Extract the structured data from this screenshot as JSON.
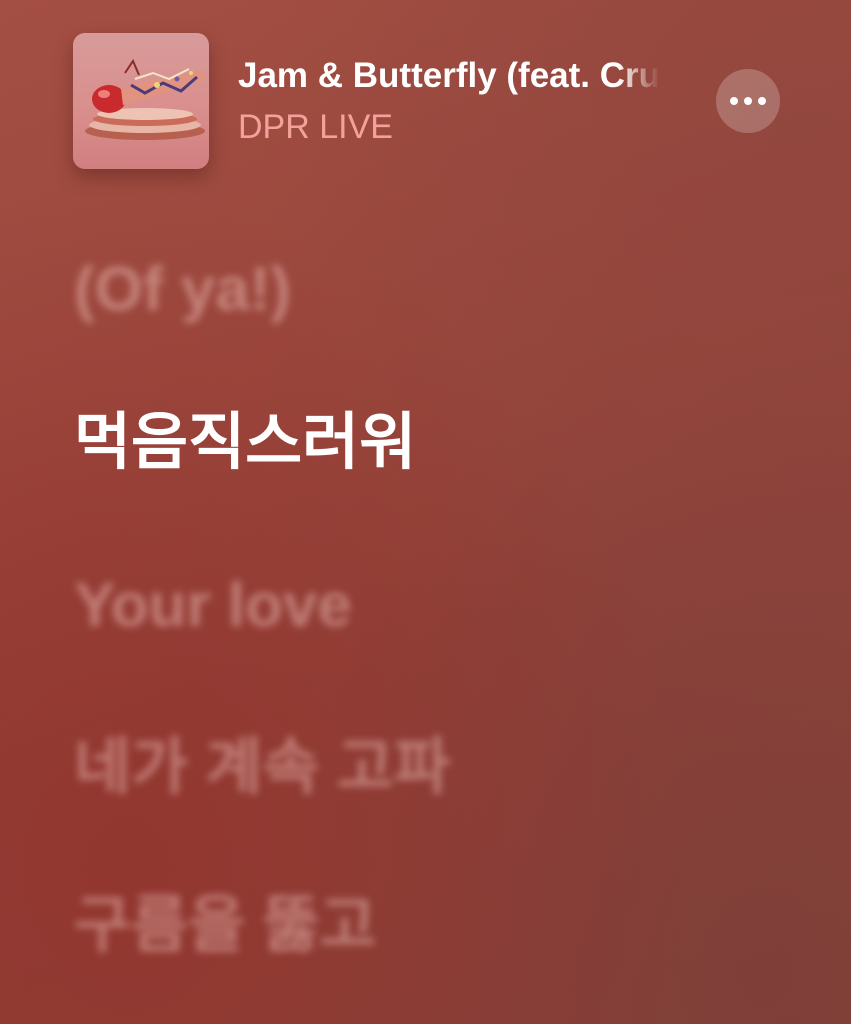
{
  "now_playing": {
    "title": "Jam & Butterfly (feat. Crush)",
    "artist": "DPR LIVE",
    "artwork_icon": "album-artwork",
    "more_icon": "ellipsis-icon"
  },
  "lyrics": {
    "lines": [
      {
        "text": "(Of ya!)",
        "active": false
      },
      {
        "text": "먹음직스러워",
        "active": true
      },
      {
        "text": "Your love",
        "active": false
      },
      {
        "text": "네가 계속 고파",
        "active": false
      },
      {
        "text": "구름을 뚫고",
        "active": false
      }
    ]
  },
  "colors": {
    "background": "#9a473d",
    "artist_accent": "#f2a29a",
    "active_lyric": "#ffffff"
  }
}
